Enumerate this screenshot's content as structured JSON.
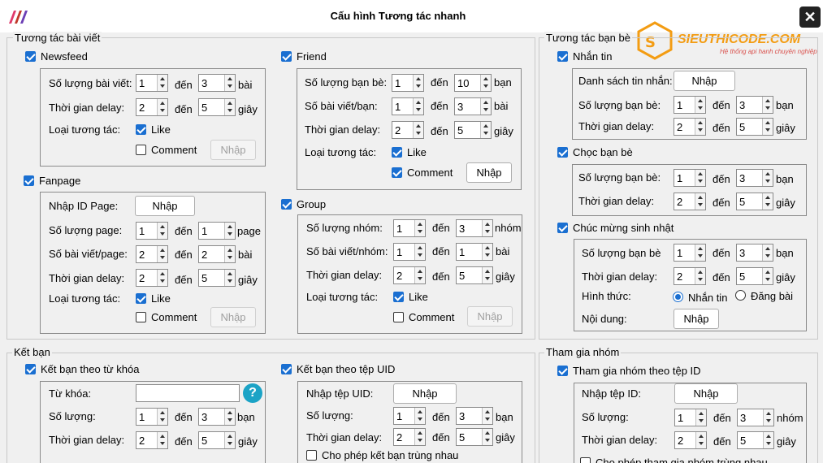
{
  "window": {
    "title": "Cấu hình Tương tác nhanh",
    "close": "✕"
  },
  "brand": {
    "name": "SIEUTHICODE.COM",
    "slogan": "Hệ thống api hanh chuyên nghiệp"
  },
  "colors": {
    "accent": "#1a6fd1",
    "help": "#1ba3c6",
    "brand": "#f39c12"
  },
  "post": {
    "label": "Tương tác bài viết",
    "newsfeed": {
      "label": "Newsfeed",
      "count_label": "Số lượng bài viết:",
      "count_from": "1",
      "count_to": "3",
      "count_unit": "bài",
      "delay_label": "Thời gian delay:",
      "delay_from": "2",
      "delay_to": "5",
      "delay_unit": "giây",
      "type_label": "Loại tương tác:",
      "like": "Like",
      "comment": "Comment",
      "nhap": "Nhập"
    },
    "fanpage": {
      "label": "Fanpage",
      "id_label": "Nhập ID Page:",
      "id_button": "Nhập",
      "page_label": "Số lượng page:",
      "page_from": "1",
      "page_to": "1",
      "page_unit": "page",
      "posts_label": "Số bài viết/page:",
      "posts_from": "2",
      "posts_to": "2",
      "posts_unit": "bài",
      "delay_label": "Thời gian delay:",
      "delay_from": "2",
      "delay_to": "5",
      "delay_unit": "giây",
      "type_label": "Loại tương tác:",
      "like": "Like",
      "comment": "Comment",
      "nhap": "Nhập"
    },
    "friend": {
      "label": "Friend",
      "count_label": "Số lượng bạn bè:",
      "count_from": "1",
      "count_to": "10",
      "count_unit": "bạn",
      "posts_label": "Số bài viết/bạn:",
      "posts_from": "1",
      "posts_to": "3",
      "posts_unit": "bài",
      "delay_label": "Thời gian delay:",
      "delay_from": "2",
      "delay_to": "5",
      "delay_unit": "giây",
      "type_label": "Loại tương tác:",
      "like": "Like",
      "comment": "Comment",
      "nhap": "Nhập"
    },
    "group": {
      "label": "Group",
      "count_label": "Số lượng nhóm:",
      "count_from": "1",
      "count_to": "3",
      "count_unit": "nhóm",
      "posts_label": "Số bài viết/nhóm:",
      "posts_from": "1",
      "posts_to": "1",
      "posts_unit": "bài",
      "delay_label": "Thời gian delay:",
      "delay_from": "2",
      "delay_to": "5",
      "delay_unit": "giây",
      "type_label": "Loại tương tác:",
      "like": "Like",
      "comment": "Comment",
      "nhap": "Nhập"
    },
    "to": "đến"
  },
  "friends": {
    "label": "Tương tác bạn bè",
    "message": {
      "label": "Nhắn tin",
      "list_label": "Danh sách tin nhắn:",
      "list_button": "Nhập",
      "count_label": "Số lượng bạn bè:",
      "count_from": "1",
      "count_to": "3",
      "count_unit": "bạn",
      "delay_label": "Thời gian delay:",
      "delay_from": "2",
      "delay_to": "5",
      "delay_unit": "giây"
    },
    "poke": {
      "label": "Chọc bạn bè",
      "count_label": "Số lượng bạn bè:",
      "count_from": "1",
      "count_to": "3",
      "count_unit": "bạn",
      "delay_label": "Thời gian delay:",
      "delay_from": "2",
      "delay_to": "5",
      "delay_unit": "giây"
    },
    "birthday": {
      "label": "Chúc mừng sinh nhật",
      "count_label": "Số lượng bạn bè",
      "count_from": "1",
      "count_to": "3",
      "count_unit": "bạn",
      "delay_label": "Thời gian delay:",
      "delay_from": "2",
      "delay_to": "5",
      "delay_unit": "giây",
      "form_label": "Hình thức:",
      "opt_message": "Nhắn tin",
      "opt_post": "Đăng bài",
      "content_label": "Nội dung:",
      "content_button": "Nhập"
    }
  },
  "addfriend": {
    "label": "Kết bạn",
    "keyword": {
      "label": "Kết bạn theo từ khóa",
      "kw_label": "Từ khóa:",
      "kw_value": "",
      "help": "?",
      "count_label": "Số lượng:",
      "count_from": "1",
      "count_to": "3",
      "count_unit": "bạn",
      "delay_label": "Thời gian delay:",
      "delay_from": "2",
      "delay_to": "5",
      "delay_unit": "giây"
    },
    "uid": {
      "label": "Kết bạn theo tệp UID",
      "file_label": "Nhập tệp UID:",
      "file_button": "Nhập",
      "count_label": "Số lượng:",
      "count_from": "1",
      "count_to": "3",
      "count_unit": "bạn",
      "delay_label": "Thời gian delay:",
      "delay_from": "2",
      "delay_to": "5",
      "delay_unit": "giây",
      "dup_label": "Cho phép kết bạn trùng nhau"
    }
  },
  "joingroup": {
    "label": "Tham gia nhóm",
    "byid": {
      "label": "Tham gia nhóm theo tệp ID",
      "file_label": "Nhập tệp ID:",
      "file_button": "Nhập",
      "count_label": "Số lượng:",
      "count_from": "1",
      "count_to": "3",
      "count_unit": "nhóm",
      "delay_label": "Thời gian delay:",
      "delay_from": "2",
      "delay_to": "5",
      "delay_unit": "giây",
      "dup_label": "Cho phép tham gia nhóm trùng nhau"
    }
  }
}
